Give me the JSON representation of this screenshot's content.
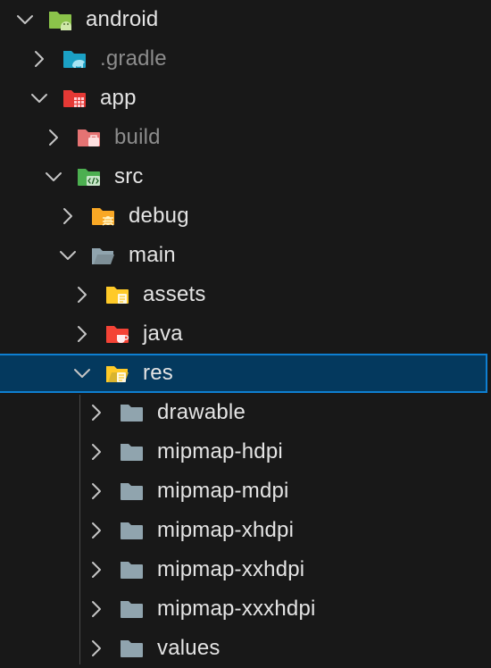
{
  "explorer": {
    "items": [
      {
        "label": "android",
        "expanded": true,
        "depth": 0,
        "icon": "android-folder-icon",
        "dim": false
      },
      {
        "label": ".gradle",
        "expanded": false,
        "depth": 1,
        "icon": "gradle-folder-icon",
        "dim": true
      },
      {
        "label": "app",
        "expanded": true,
        "depth": 1,
        "icon": "app-folder-icon",
        "dim": false
      },
      {
        "label": "build",
        "expanded": false,
        "depth": 2,
        "icon": "build-folder-icon",
        "dim": true
      },
      {
        "label": "src",
        "expanded": true,
        "depth": 2,
        "icon": "src-folder-icon",
        "dim": false
      },
      {
        "label": "debug",
        "expanded": false,
        "depth": 3,
        "icon": "debug-folder-icon",
        "dim": false
      },
      {
        "label": "main",
        "expanded": true,
        "depth": 3,
        "icon": "folder-open-icon",
        "dim": false
      },
      {
        "label": "assets",
        "expanded": false,
        "depth": 4,
        "icon": "assets-folder-icon",
        "dim": false
      },
      {
        "label": "java",
        "expanded": false,
        "depth": 4,
        "icon": "java-folder-icon",
        "dim": false
      },
      {
        "label": "res",
        "expanded": true,
        "depth": 4,
        "icon": "res-folder-icon",
        "dim": false,
        "selected": true
      },
      {
        "label": "drawable",
        "expanded": false,
        "depth": 5,
        "icon": "folder-icon",
        "dim": false
      },
      {
        "label": "mipmap-hdpi",
        "expanded": false,
        "depth": 5,
        "icon": "folder-icon",
        "dim": false
      },
      {
        "label": "mipmap-mdpi",
        "expanded": false,
        "depth": 5,
        "icon": "folder-icon",
        "dim": false
      },
      {
        "label": "mipmap-xhdpi",
        "expanded": false,
        "depth": 5,
        "icon": "folder-icon",
        "dim": false
      },
      {
        "label": "mipmap-xxhdpi",
        "expanded": false,
        "depth": 5,
        "icon": "folder-icon",
        "dim": false
      },
      {
        "label": "mipmap-xxxhdpi",
        "expanded": false,
        "depth": 5,
        "icon": "folder-icon",
        "dim": false
      },
      {
        "label": "values",
        "expanded": false,
        "depth": 5,
        "icon": "folder-icon",
        "dim": false
      }
    ]
  },
  "colors": {
    "background": "#181818",
    "selection": "#04395e",
    "selection_border": "#0e7fd1",
    "text": "#e4e4e4",
    "text_dim": "#8c8c8c",
    "android_green": "#8bc34a",
    "gradle_blue": "#1ba1c5",
    "app_red": "#e53935",
    "build_pink": "#e57373",
    "src_green": "#4caf50",
    "debug_orange": "#f9a825",
    "assets_yellow": "#ffca28",
    "java_red": "#f44336",
    "folder_gray": "#90a4ae"
  }
}
